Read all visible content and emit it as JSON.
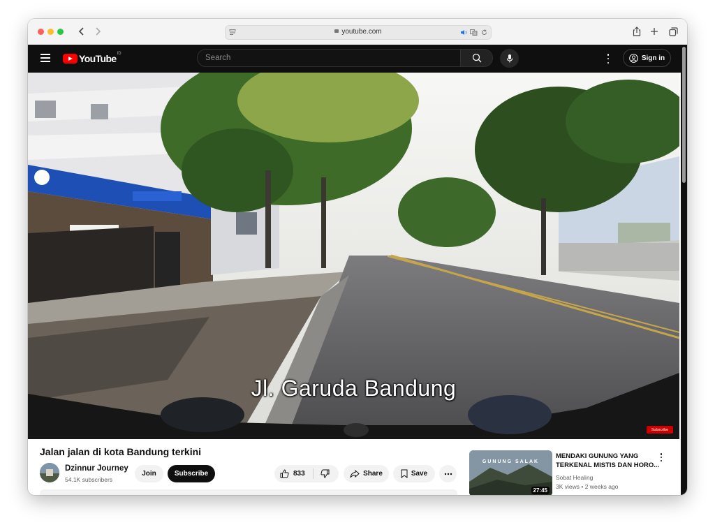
{
  "browser": {
    "url": "youtube.com"
  },
  "header": {
    "logo_text": "YouTube",
    "logo_country": "ID",
    "search_placeholder": "Search",
    "sign_in_label": "Sign in"
  },
  "video": {
    "caption": "Jl. Garuda Bandung",
    "watermark": "Subscribe",
    "title": "Jalan jalan di kota Bandung terkini"
  },
  "channel": {
    "name": "Dzinnur Journey",
    "subscribers": "54.1K subscribers",
    "join_label": "Join",
    "subscribe_label": "Subscribe"
  },
  "actions": {
    "likes": "833",
    "share_label": "Share",
    "save_label": "Save"
  },
  "recommendation": {
    "thumb_text": "GUNUNG SALAK",
    "duration": "27:45",
    "title_line1": "MENDAKI GUNUNG YANG",
    "title_line2": "TERKENAL MISTIS DAN HORO...",
    "channel": "Sobat Healing",
    "meta": "3K views • 2 weeks ago"
  },
  "colors": {
    "brand_red": "#ff0000",
    "header_bg": "#0f0f0f"
  }
}
